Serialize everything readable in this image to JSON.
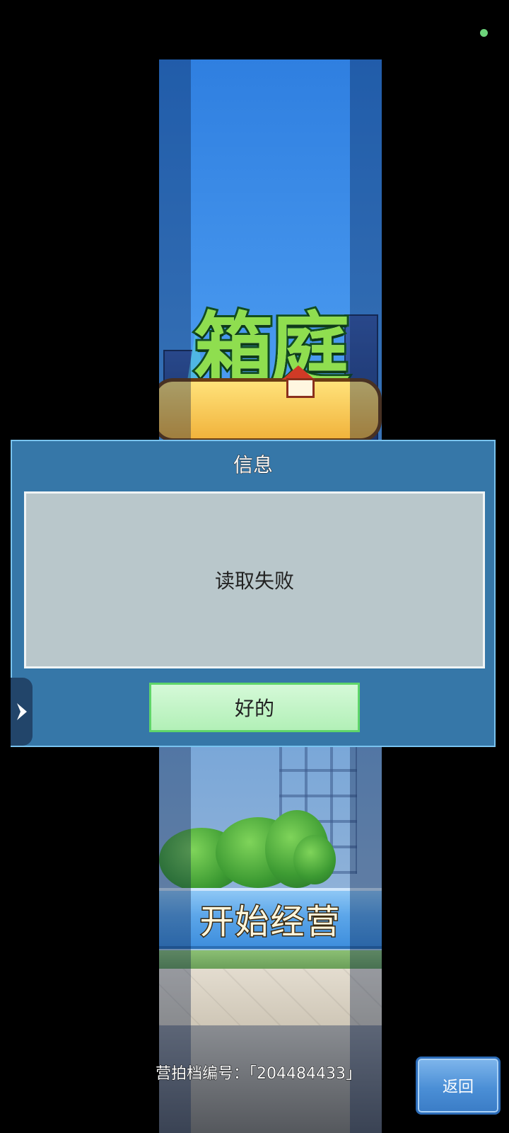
{
  "dialog": {
    "title": "信息",
    "message": "读取失败",
    "ok_label": "好的"
  },
  "game": {
    "start_label": "开始经营",
    "save_id_text": "营拍档编号：「204484433」"
  },
  "back_label": "返回",
  "icons": {
    "side_tab": "chevron-right-icon",
    "status": "status-dot"
  },
  "colors": {
    "dialog_bg": "#3677a8",
    "dialog_border": "#79c3ef",
    "message_panel": "#b9c7cb",
    "ok_button": "#b2f0b7",
    "back_button": "#4b8fd6"
  }
}
